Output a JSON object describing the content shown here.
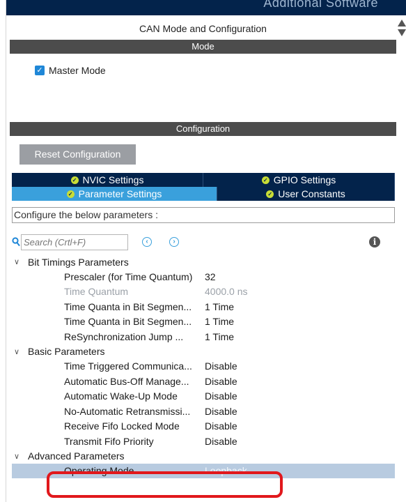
{
  "topbar": {
    "text": "Additional Software"
  },
  "panel": {
    "title": "CAN Mode and Configuration"
  },
  "mode": {
    "header": "Mode",
    "master_mode": {
      "label": "Master Mode",
      "checked": true
    }
  },
  "configuration": {
    "header": "Configuration",
    "reset_label": "Reset Configuration",
    "tabs_row1": [
      {
        "label": "NVIC Settings",
        "active": false
      },
      {
        "label": "GPIO Settings",
        "active": false
      }
    ],
    "tabs_row2": [
      {
        "label": "Parameter Settings",
        "active": true
      },
      {
        "label": "User Constants",
        "active": false
      }
    ],
    "description": "Configure the below parameters :",
    "search": {
      "placeholder": "Search (Crtl+F)"
    }
  },
  "groups": [
    {
      "label": "Bit Timings Parameters",
      "items": [
        {
          "name": "Prescaler (for Time Quantum)",
          "value": "32"
        },
        {
          "name": "Time Quantum",
          "value": "4000.0 ns",
          "dim": true
        },
        {
          "name": "Time Quanta in Bit Segmen...",
          "value": "1 Time"
        },
        {
          "name": "Time Quanta in Bit Segmen...",
          "value": "1 Time"
        },
        {
          "name": "ReSynchronization Jump ...",
          "value": "1 Time"
        }
      ]
    },
    {
      "label": "Basic Parameters",
      "items": [
        {
          "name": "Time Triggered Communica...",
          "value": "Disable"
        },
        {
          "name": "Automatic Bus-Off Manage...",
          "value": "Disable"
        },
        {
          "name": "Automatic Wake-Up Mode",
          "value": "Disable"
        },
        {
          "name": "No-Automatic Retransmissi...",
          "value": "Disable"
        },
        {
          "name": "Receive Fifo Locked Mode",
          "value": "Disable"
        },
        {
          "name": "Transmit Fifo Priority",
          "value": "Disable"
        }
      ]
    },
    {
      "label": "Advanced Parameters",
      "items": [
        {
          "name": "Operating Mode",
          "value": "Loopback",
          "selected": true
        }
      ]
    }
  ],
  "colors": {
    "highlight": "#e1181c",
    "tab_dark": "#03234b",
    "tab_active": "#3aa0dc",
    "check_ok": "#c8dd36"
  }
}
